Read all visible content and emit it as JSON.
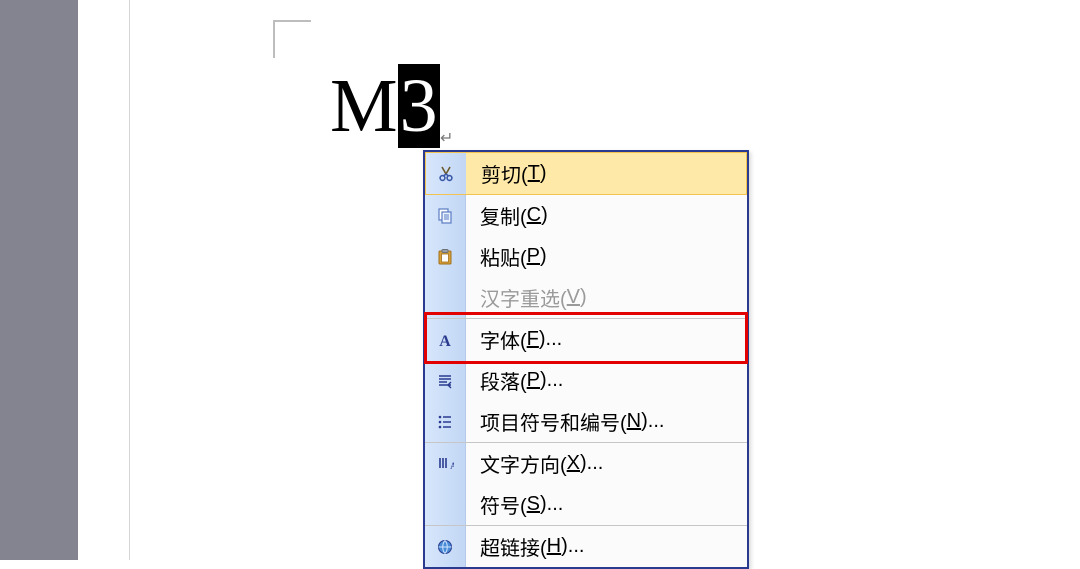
{
  "document": {
    "text_before_selection": "M",
    "selected_text": "3"
  },
  "context_menu": {
    "items": [
      {
        "icon": "cut-icon",
        "label_pre": "剪切(",
        "hotkey": "T",
        "label_post": ")",
        "disabled": false,
        "hovered": true,
        "sep": false
      },
      {
        "icon": "copy-icon",
        "label_pre": "复制(",
        "hotkey": "C",
        "label_post": ")",
        "disabled": false,
        "hovered": false,
        "sep": false
      },
      {
        "icon": "paste-icon",
        "label_pre": "粘贴(",
        "hotkey": "P",
        "label_post": ")",
        "disabled": false,
        "hovered": false,
        "sep": false
      },
      {
        "icon": "",
        "label_pre": "汉字重选(",
        "hotkey": "V",
        "label_post": ")",
        "disabled": true,
        "hovered": false,
        "sep": false
      },
      {
        "icon": "font-icon",
        "label_pre": "字体(",
        "hotkey": "F",
        "label_post": ")...",
        "disabled": false,
        "hovered": false,
        "sep": true,
        "highlighted": true
      },
      {
        "icon": "paragraph-icon",
        "label_pre": "段落(",
        "hotkey": "P",
        "label_post": ")...",
        "disabled": false,
        "hovered": false,
        "sep": false
      },
      {
        "icon": "bullets-icon",
        "label_pre": "项目符号和编号(",
        "hotkey": "N",
        "label_post": ")...",
        "disabled": false,
        "hovered": false,
        "sep": false
      },
      {
        "icon": "textdir-icon",
        "label_pre": "文字方向(",
        "hotkey": "X",
        "label_post": ")...",
        "disabled": false,
        "hovered": false,
        "sep": true
      },
      {
        "icon": "",
        "label_pre": "符号(",
        "hotkey": "S",
        "label_post": ")...",
        "disabled": false,
        "hovered": false,
        "sep": false
      },
      {
        "icon": "hyperlink-icon",
        "label_pre": "超链接(",
        "hotkey": "H",
        "label_post": ")...",
        "disabled": false,
        "hovered": false,
        "sep": true
      }
    ]
  }
}
